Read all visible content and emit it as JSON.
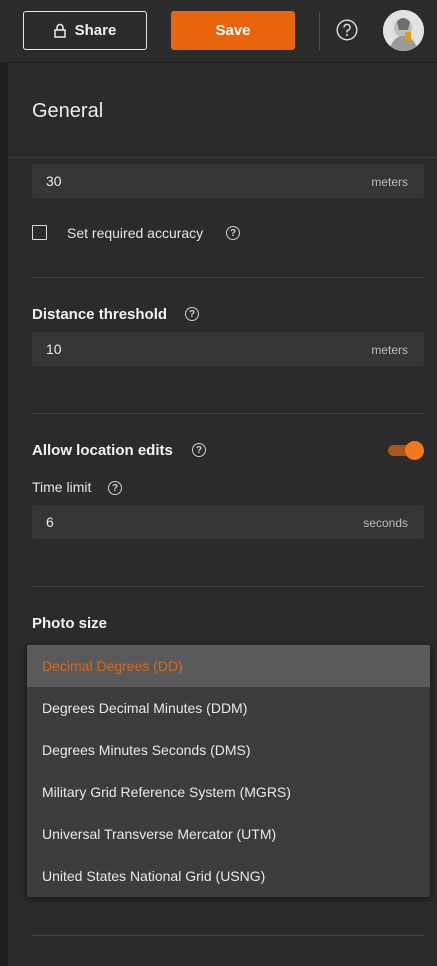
{
  "topbar": {
    "share_label": "Share",
    "save_label": "Save"
  },
  "panel": {
    "title": "General",
    "accuracy": {
      "value": "30",
      "unit": "meters"
    },
    "required_accuracy_label": "Set required accuracy",
    "distance_threshold": {
      "label": "Distance threshold",
      "value": "10",
      "unit": "meters"
    },
    "allow_location_edits": {
      "label": "Allow location edits",
      "enabled": true
    },
    "time_limit": {
      "label": "Time limit",
      "value": "6",
      "unit": "seconds"
    },
    "photo_size_label": "Photo size"
  },
  "dropdown": {
    "options": [
      "Decimal Degrees (DD)",
      "Degrees Decimal Minutes (DDM)",
      "Degrees Minutes Seconds (DMS)",
      "Military Grid Reference System (MGRS)",
      "Universal Transverse Mercator (UTM)",
      "United States National Grid (USNG)"
    ],
    "selected_index": 0
  },
  "colors": {
    "accent": "#e8650e",
    "background": "#2b2b2b",
    "field": "#353535"
  }
}
